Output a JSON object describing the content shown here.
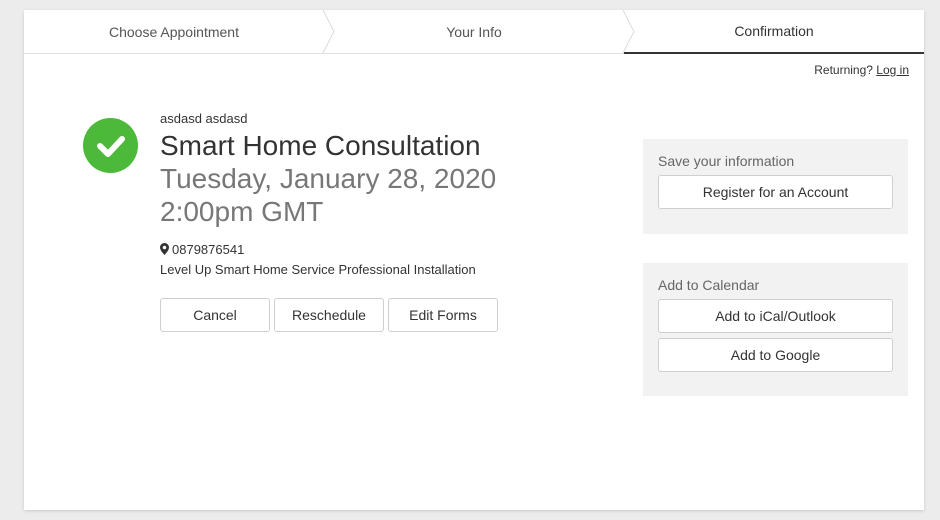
{
  "steps": [
    {
      "label": "Choose Appointment"
    },
    {
      "label": "Your Info"
    },
    {
      "label": "Confirmation"
    }
  ],
  "returning": {
    "text": "Returning?",
    "link": "Log in"
  },
  "appointment": {
    "client_name": "asdasd asdasd",
    "title": "Smart Home Consultation",
    "date": "Tuesday, January 28, 2020",
    "time": "2:00pm GMT",
    "phone": "0879876541",
    "service": "Level Up Smart Home Service Professional Installation"
  },
  "actions": {
    "cancel": "Cancel",
    "reschedule": "Reschedule",
    "edit_forms": "Edit Forms"
  },
  "save_panel": {
    "title": "Save your information",
    "register": "Register for an Account"
  },
  "calendar_panel": {
    "title": "Add to Calendar",
    "ical": "Add to iCal/Outlook",
    "google": "Add to Google"
  },
  "colors": {
    "success": "#4cb93a",
    "panel_bg": "#f2f2f2"
  },
  "icons": [
    "check-circle-icon",
    "map-marker-icon",
    "chevron-divider-icon"
  ]
}
